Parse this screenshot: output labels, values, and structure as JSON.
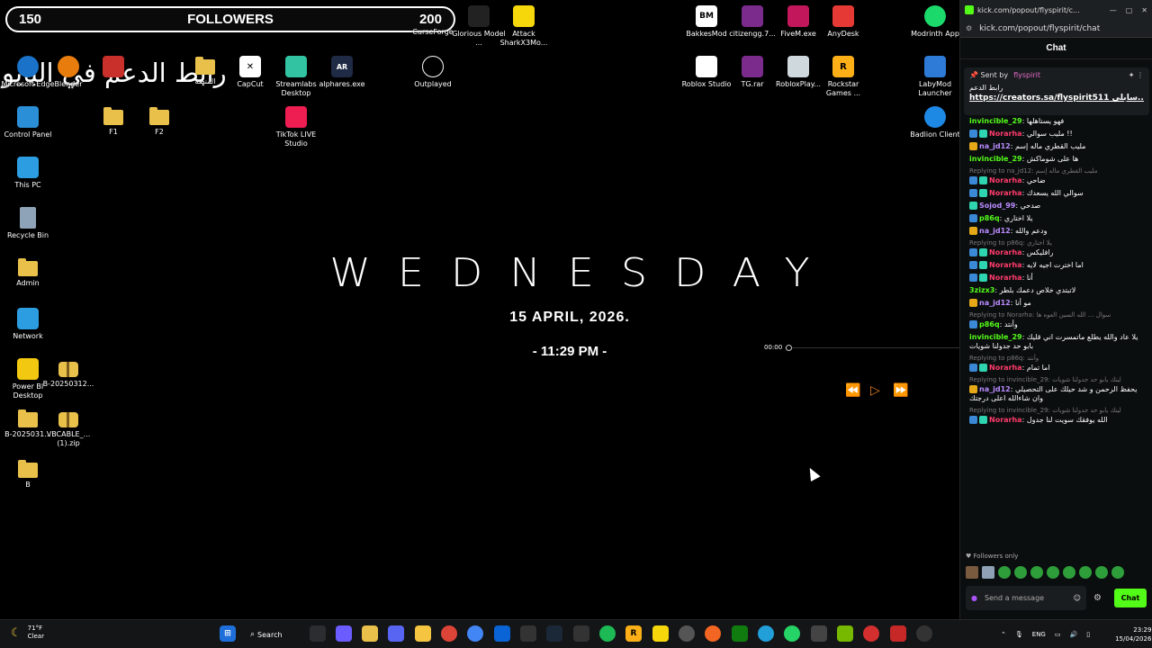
{
  "followers_bar": {
    "left": "150",
    "title": "FOLLOWERS",
    "right": "200"
  },
  "overlay_arabic": "رابط الدعم في البايو",
  "clock": {
    "day": "WEDNESDAY",
    "date": "15 APRIL, 2026.",
    "time": "- 11:29 PM -"
  },
  "media": {
    "time": "00:00"
  },
  "desktop_icons": [
    {
      "label": "Microsoft Edge",
      "kind": "edge"
    },
    {
      "label": "Blender",
      "kind": "blender"
    },
    {
      "label": "",
      "kind": "app"
    },
    {
      "label": "المنصة",
      "kind": "folder"
    },
    {
      "label": "CapCut",
      "kind": "capcut"
    },
    {
      "label": "Streamlabs Desktop",
      "kind": "streamlabs"
    },
    {
      "label": "alphares.exe",
      "kind": "alphares"
    },
    {
      "label": "Outplayed",
      "kind": "outplayed"
    },
    {
      "label": "Control Panel",
      "kind": "control"
    },
    {
      "label": "F1",
      "kind": "folder"
    },
    {
      "label": "F2",
      "kind": "folder"
    },
    {
      "label": "TikTok LIVE Studio",
      "kind": "tiktok"
    },
    {
      "label": "This PC",
      "kind": "pc"
    },
    {
      "label": "Recycle Bin",
      "kind": "bin"
    },
    {
      "label": "Admin",
      "kind": "folder"
    },
    {
      "label": "Network",
      "kind": "network"
    },
    {
      "label": "Power BI Desktop",
      "kind": "powerbi"
    },
    {
      "label": "B-20250312...",
      "kind": "zip"
    },
    {
      "label": "B-2025031...",
      "kind": "folder"
    },
    {
      "label": "VBCABLE_... (1).zip",
      "kind": "zip"
    },
    {
      "label": "B",
      "kind": "folder"
    },
    {
      "label": "Glorious Model ...",
      "kind": "glorious"
    },
    {
      "label": "Attack SharkX3Mo...",
      "kind": "attack"
    },
    {
      "label": "CurseForge",
      "kind": "curse"
    },
    {
      "label": "BakkesMod",
      "kind": "bakkes"
    },
    {
      "label": "citizengg.7...",
      "kind": "rar"
    },
    {
      "label": "FiveM.exe",
      "kind": "fivem"
    },
    {
      "label": "AnyDesk",
      "kind": "anydesk"
    },
    {
      "label": "Modrinth App",
      "kind": "modrinth"
    },
    {
      "label": "Roblox Studio",
      "kind": "robloxstudio"
    },
    {
      "label": "TG.rar",
      "kind": "rar"
    },
    {
      "label": "RobloxPlay...",
      "kind": "roblox"
    },
    {
      "label": "Rockstar Games ...",
      "kind": "rockstar"
    },
    {
      "label": "LabyMod Launcher",
      "kind": "laby"
    },
    {
      "label": "Badlion Client",
      "kind": "badlion"
    }
  ],
  "chat": {
    "window_title": "kick.com/popout/flyspirit/c...",
    "url": "kick.com/popout/flyspirit/chat",
    "header": "Chat",
    "pinned": {
      "sent_by_label": "Sent by",
      "sent_by_user": "flyspirit",
      "message": "رابط الدعم",
      "link": "https://creators.sa/flyspirit511 سابلي..."
    },
    "messages": [
      {
        "user": "invincible_29",
        "color": "#53fc18",
        "badges": [],
        "reply": "",
        "text": "فهو يستاهلها"
      },
      {
        "user": "Norarha",
        "color": "#ff3b6b",
        "badges": [
          "blue",
          "teal"
        ],
        "reply": "",
        "text": "مليب سوالي !!"
      },
      {
        "user": "na_jd12",
        "color": "#b98cff",
        "badges": [
          "gold"
        ],
        "reply": "",
        "text": "مليب القطري ماله إسم"
      },
      {
        "user": "invincible_29",
        "color": "#53fc18",
        "badges": [],
        "reply": "",
        "text": "ها على شوماكش"
      },
      {
        "user": "Norarha",
        "color": "#ff3b6b",
        "badges": [
          "blue",
          "teal"
        ],
        "reply": "Replying to na_jd12: مليب القطري ماله إسم",
        "text": "ضاحي"
      },
      {
        "user": "Norarha",
        "color": "#ff3b6b",
        "badges": [
          "blue",
          "teal"
        ],
        "reply": "",
        "text": "سوالي الله يسعدك"
      },
      {
        "user": "Sojod_99",
        "color": "#b98cff",
        "badges": [
          "teal"
        ],
        "reply": "",
        "text": "صدحي"
      },
      {
        "user": "p86q",
        "color": "#53fc18",
        "badges": [
          "blue"
        ],
        "reply": "",
        "text": "يلا اختاري"
      },
      {
        "user": "na_jd12",
        "color": "#b98cff",
        "badges": [
          "gold"
        ],
        "reply": "",
        "text": "ودعم والله"
      },
      {
        "user": "Norarha",
        "color": "#ff3b6b",
        "badges": [
          "blue",
          "teal"
        ],
        "reply": "Replying to p86q: يلا اختاري",
        "text": "رافليكس"
      },
      {
        "user": "Norarha",
        "color": "#ff3b6b",
        "badges": [
          "blue",
          "teal"
        ],
        "reply": "",
        "text": "اما اخترت اجيه لايه"
      },
      {
        "user": "Norarha",
        "color": "#ff3b6b",
        "badges": [
          "blue",
          "teal"
        ],
        "reply": "",
        "text": "أنا"
      },
      {
        "user": "3zizx3",
        "color": "#53fc18",
        "badges": [],
        "reply": "",
        "text": "لاتبتدي خلاص دعمك بلطر"
      },
      {
        "user": "na_jd12",
        "color": "#b98cff",
        "badges": [
          "gold"
        ],
        "reply": "",
        "text": "مو أنا"
      },
      {
        "user": "p86q",
        "color": "#53fc18",
        "badges": [
          "blue"
        ],
        "reply": "Replying to Norarha: سوال ... الله السين العوه ها",
        "text": "وأنتد"
      },
      {
        "user": "invincible_29",
        "color": "#53fc18",
        "badges": [],
        "reply": "",
        "text": "يلا عاد والله يطلع ماتمسرت اني قليك بابو حد جدولنا شويات"
      },
      {
        "user": "Norarha",
        "color": "#ff3b6b",
        "badges": [
          "blue",
          "teal"
        ],
        "reply": "Replying to p86q: وأنتد",
        "text": "اما تمام"
      },
      {
        "user": "na_jd12",
        "color": "#b98cff",
        "badges": [
          "gold"
        ],
        "reply": "Replying to invincible_29: ليتك يابو حد جدولنا شويات",
        "text": "يحفظ الرحمن و شد حيلك على التحصيلي وان شاءالله اعلى درجتك"
      },
      {
        "user": "Norarha",
        "color": "#ff3b6b",
        "badges": [
          "blue",
          "teal"
        ],
        "reply": "Replying to invincible_29: ليتك يابو حد جدولنا شويات",
        "text": "الله يوفقك سويت لنا جدول"
      }
    ],
    "followers_only": "Followers only",
    "input_placeholder": "Send a message",
    "send_button": "Chat"
  },
  "taskbar": {
    "weather_temp": "71°F",
    "weather_desc": "Clear",
    "search_label": "Search",
    "language": "ENG",
    "time": "23:29",
    "date": "15/04/2026"
  },
  "colors": {
    "kick_green": "#53fc18",
    "media_orange": "#e67e22",
    "taskbar": "#141517"
  }
}
